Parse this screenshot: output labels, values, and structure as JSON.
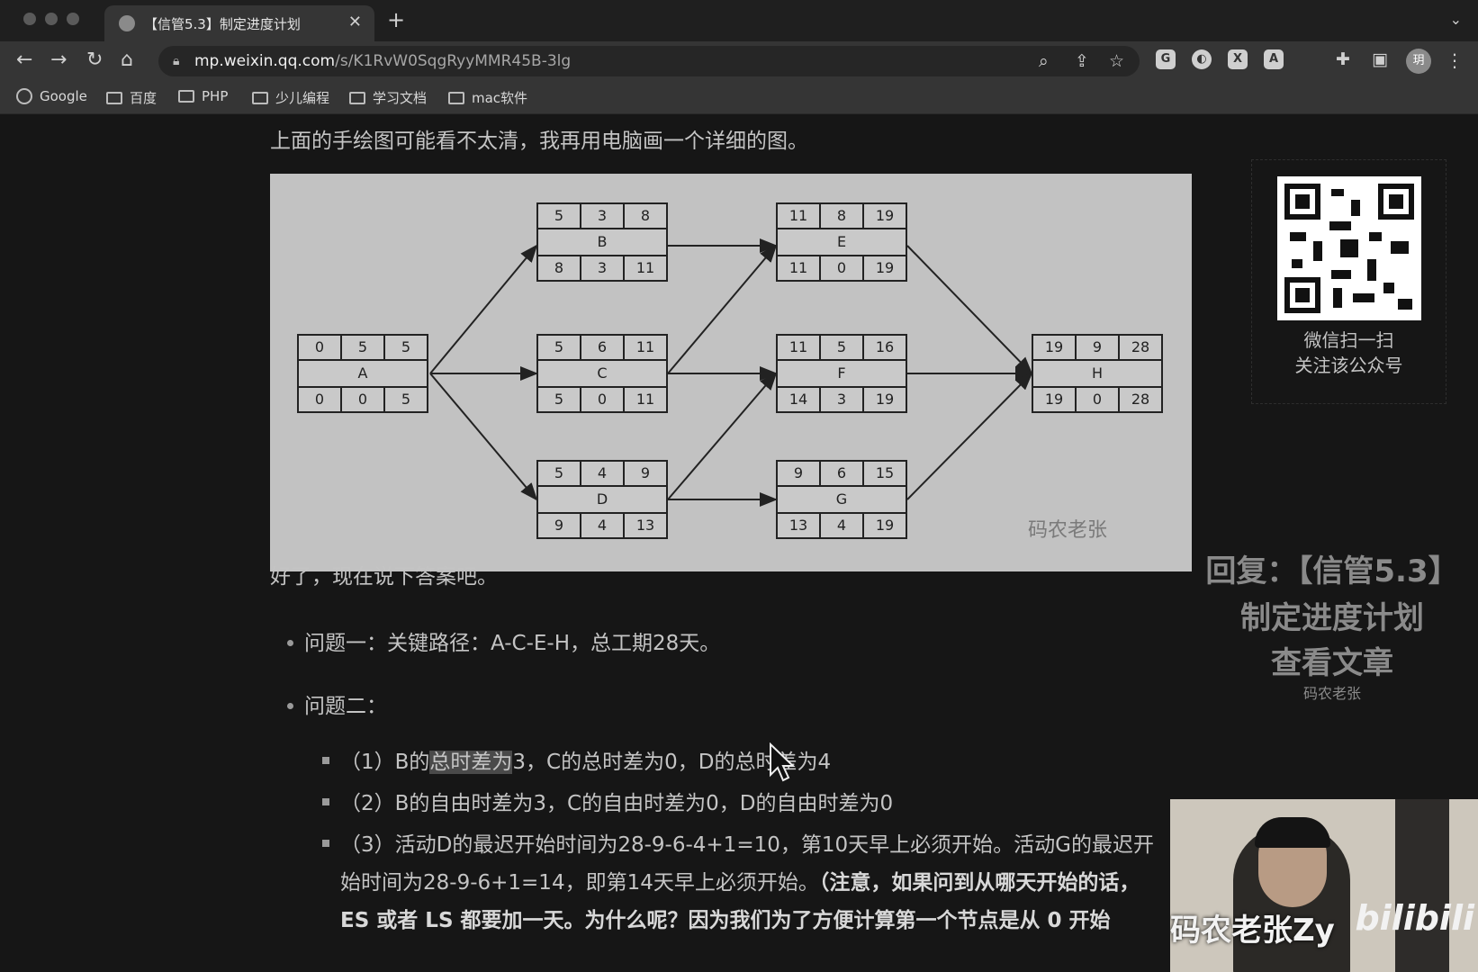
{
  "browser": {
    "tab_title": "【信管5.3】制定进度计划",
    "url_host": "mp.weixin.qq.com",
    "url_path": "/s/K1RvW0SqgRyyMMR45B-3lg",
    "bookmarks": [
      "Google",
      "百度",
      "PHP",
      "少儿编程",
      "学习文档",
      "mac软件"
    ],
    "profile_initial": "玥"
  },
  "article": {
    "intro": "上面的手绘图可能看不太清，我再用电脑画一个详细的图。",
    "answer_intro": "好了，现在说下答案吧。",
    "q1": "问题一：关键路径：A-C-E-H，总工期28天。",
    "q2": "问题二：",
    "item1_a": "（1）B的",
    "item1_hl": "总时差为",
    "item1_b": "3，C的总时差为0，D的总时差为4",
    "item2": "（2）B的自由时差为3，C的自由时差为0，D的自由时差为0",
    "item3_line1": "（3）活动D的最迟开始时间为28-9-6-4+1=10，第10天早上必须开始。活动G的最迟开",
    "item3_line2_a": "始时间为28-9-6+1=14，即第14天早上必须开始。",
    "item3_line2_b": "（注意，如果问到从哪天开始的话，",
    "item3_line3": "ES 或者 LS 都要加一天。为什么呢？因为我们为了方便计算第一个节点是从 0 开始"
  },
  "diagram": {
    "watermark": "码农老张",
    "nodes": [
      {
        "id": "A",
        "top": [
          "0",
          "5",
          "5"
        ],
        "bottom": [
          "0",
          "0",
          "5"
        ]
      },
      {
        "id": "B",
        "top": [
          "5",
          "3",
          "8"
        ],
        "bottom": [
          "8",
          "3",
          "11"
        ]
      },
      {
        "id": "C",
        "top": [
          "5",
          "6",
          "11"
        ],
        "bottom": [
          "5",
          "0",
          "11"
        ]
      },
      {
        "id": "D",
        "top": [
          "5",
          "4",
          "9"
        ],
        "bottom": [
          "9",
          "4",
          "13"
        ]
      },
      {
        "id": "E",
        "top": [
          "11",
          "8",
          "19"
        ],
        "bottom": [
          "11",
          "0",
          "19"
        ]
      },
      {
        "id": "F",
        "top": [
          "11",
          "5",
          "16"
        ],
        "bottom": [
          "14",
          "3",
          "19"
        ]
      },
      {
        "id": "G",
        "top": [
          "9",
          "6",
          "15"
        ],
        "bottom": [
          "13",
          "4",
          "19"
        ]
      },
      {
        "id": "H",
        "top": [
          "19",
          "9",
          "28"
        ],
        "bottom": [
          "19",
          "0",
          "28"
        ]
      }
    ]
  },
  "sidebar": {
    "qr_line1": "微信扫一扫",
    "qr_line2": "关注该公众号",
    "reply_line1": "回复：【信管5.3】",
    "reply_line2": "制定进度计划",
    "reply_line3": "查看文章",
    "reply_author": "码农老张"
  },
  "webcam": {
    "overlay_text": "码农老张Zy",
    "logo": "bilibili"
  }
}
